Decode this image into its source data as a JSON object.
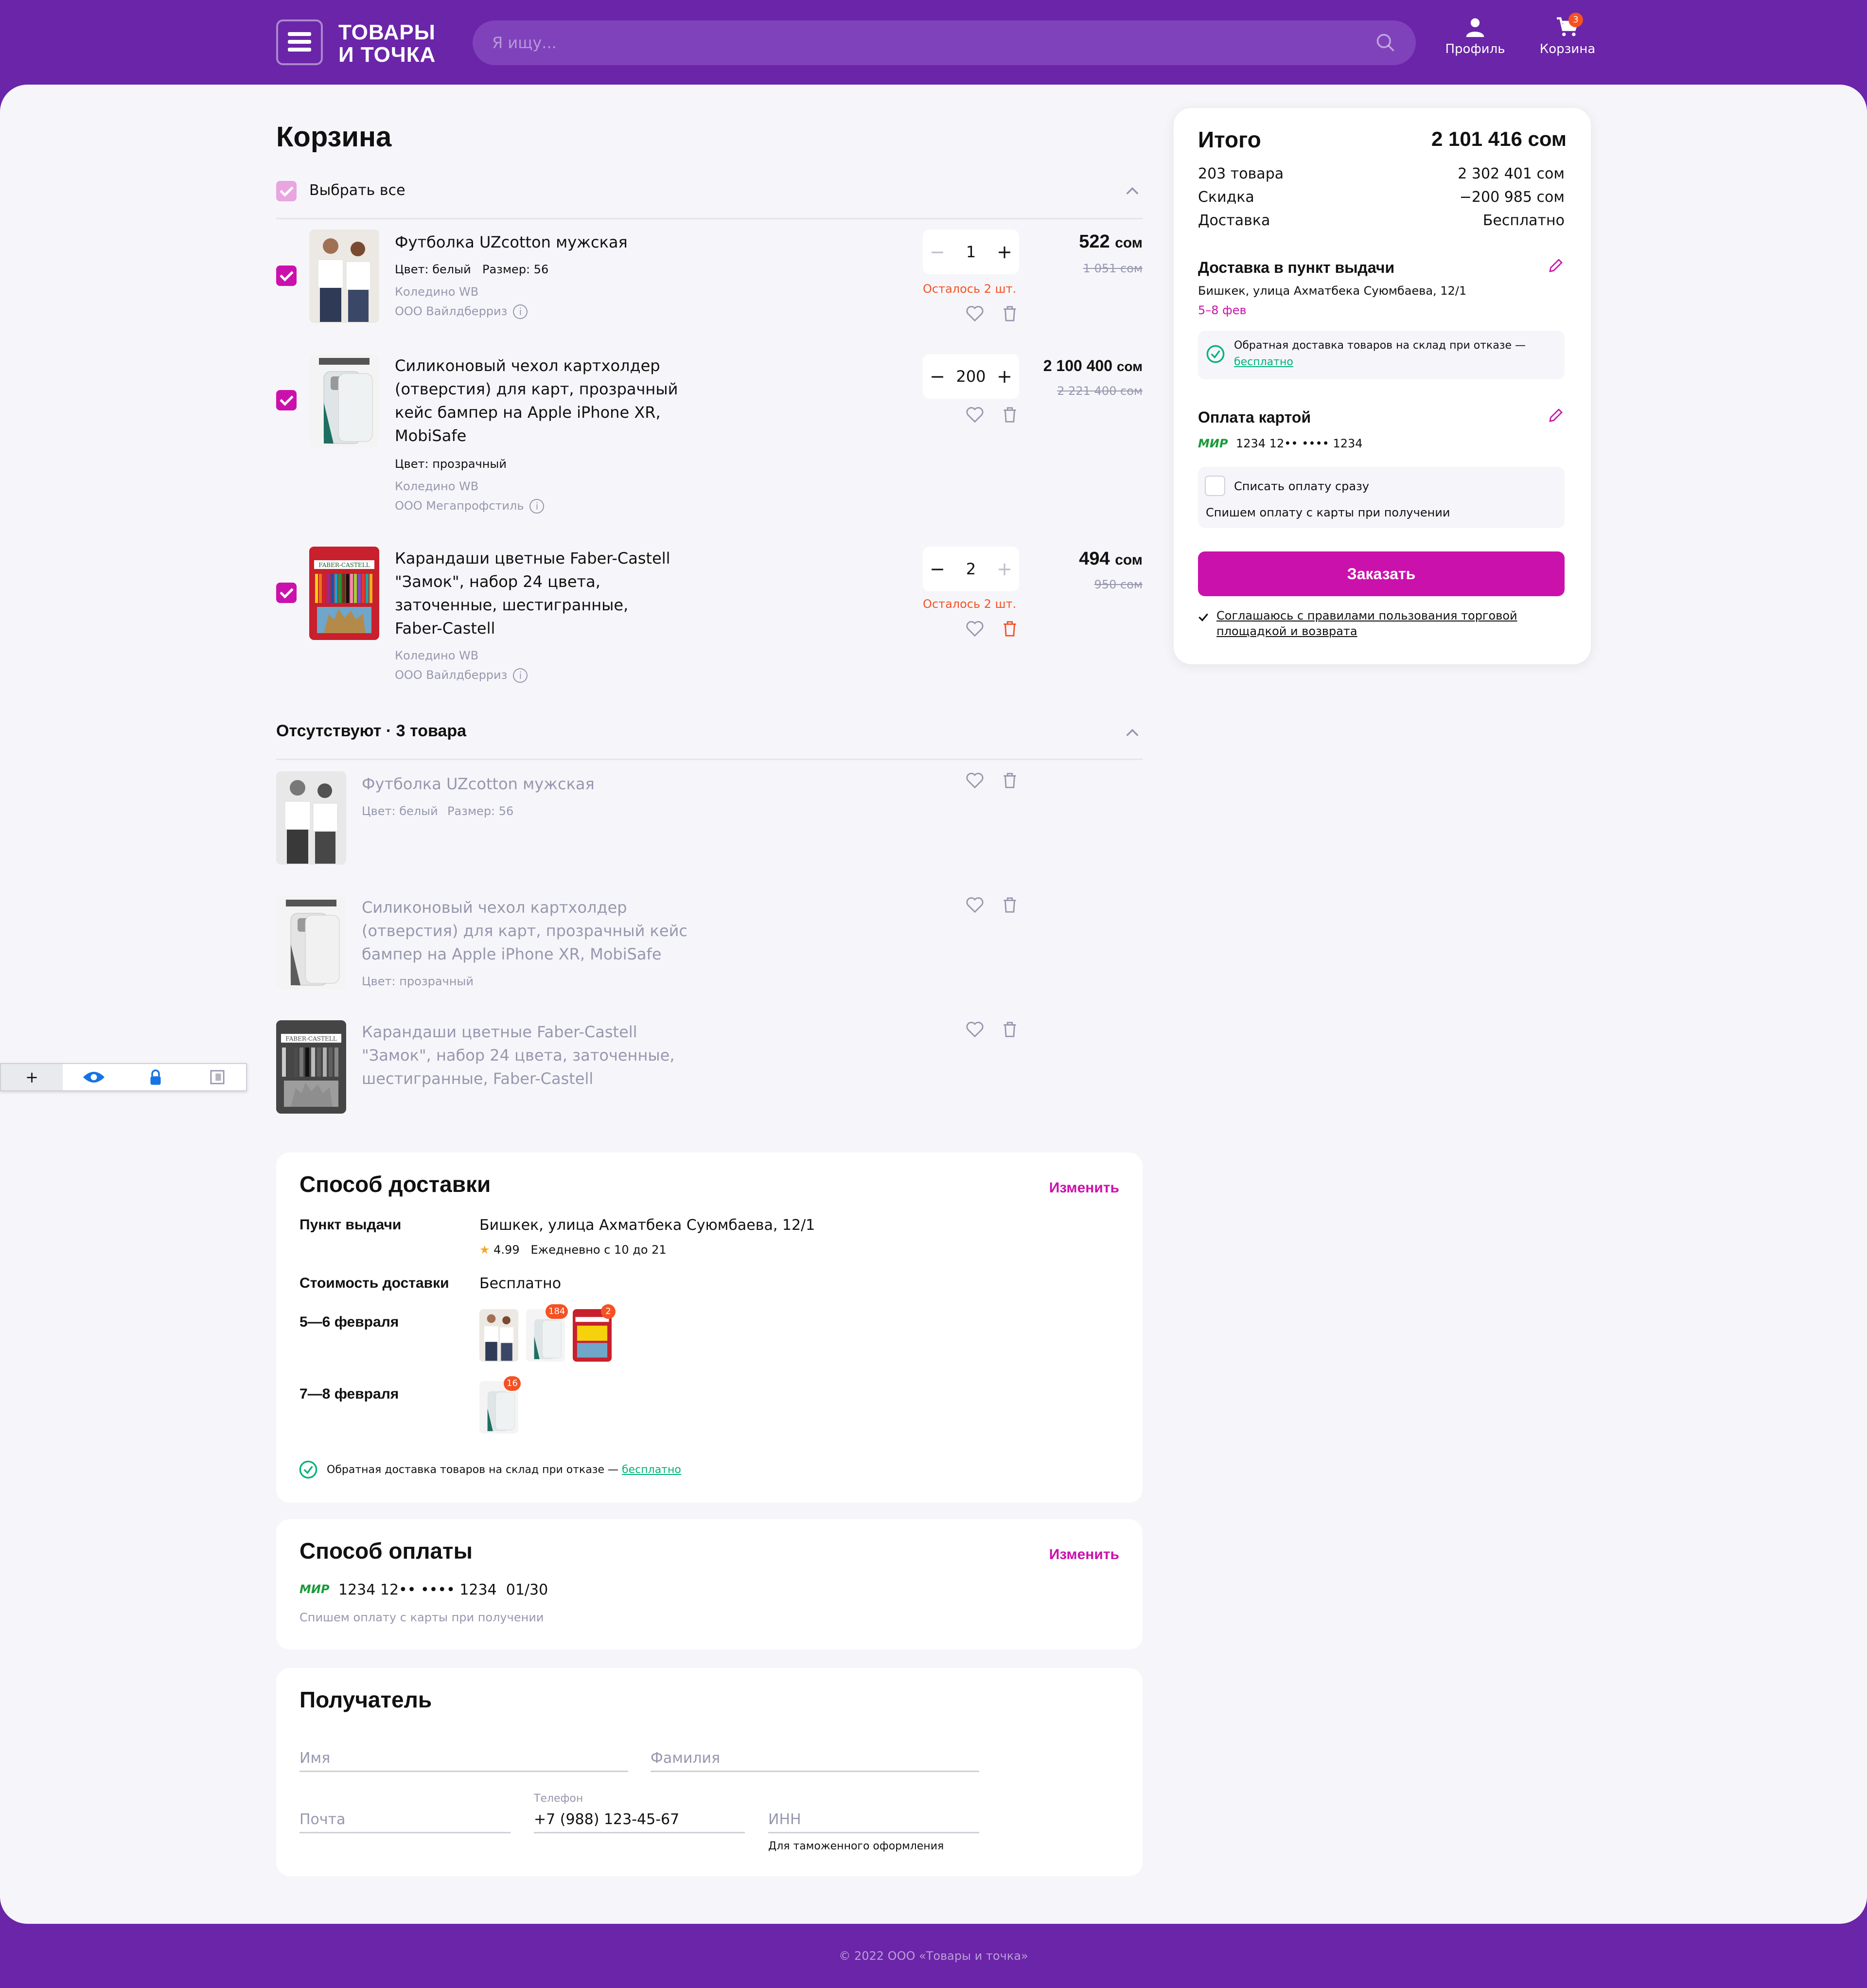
{
  "header": {
    "logo_line1": "ТОВАРЫ",
    "logo_line2": "И ТОЧКА",
    "search_placeholder": "Я ищу...",
    "profile_label": "Профиль",
    "cart_label": "Корзина",
    "cart_count": "3"
  },
  "cart": {
    "title": "Корзина",
    "select_all": "Выбрать все",
    "items": [
      {
        "title": "Футболка UZcotton мужская",
        "color": "Цвет: белый",
        "size": "Размер: 56",
        "warehouse": "Коледино WB",
        "seller": "ООО Вайлдберриз",
        "qty": "1",
        "left_note": "Осталось 2 шт.",
        "price": "522",
        "currency": "сом",
        "old_price": "1 051 сом"
      },
      {
        "title_lines": [
          "Силиконовый чехол картхолдер",
          "(отверстия) для карт, прозрачный",
          "кейс бампер на Apple iPhone XR,",
          "MobiSafe"
        ],
        "color": "Цвет: прозрачный",
        "warehouse": "Коледино WB",
        "seller": "ООО Мегапрофстиль",
        "qty": "200",
        "price": "2 100 400",
        "currency": "сом",
        "old_price": "2 221 400 сом"
      },
      {
        "title_lines": [
          "Карандаши цветные Faber-Castell",
          "\"Замок\", набор 24 цвета,",
          "заточенные, шестигранные,",
          "Faber-Castell"
        ],
        "warehouse": "Коледино WB",
        "seller": "ООО Вайлдберриз",
        "qty": "2",
        "left_note": "Осталось 2 шт.",
        "price": "494",
        "currency": "сом",
        "old_price": "950 сом"
      }
    ]
  },
  "missing": {
    "title": "Отсутствуют · 3 товара",
    "items": [
      {
        "title": "Футболка UZcotton мужская",
        "color": "Цвет: белый",
        "size": "Размер: 56"
      },
      {
        "title_lines": [
          "Силиконовый чехол картхолдер",
          "(отверстия) для карт, прозрачный кейс",
          "бампер на Apple iPhone XR, MobiSafe"
        ],
        "color": "Цвет: прозрачный"
      },
      {
        "title_lines": [
          "Карандаши цветные Faber-Castell",
          "\"Замок\", набор 24 цвета, заточенные,",
          "шестигранные, Faber-Castell"
        ]
      }
    ]
  },
  "summary": {
    "title": "Итого",
    "total": "2 101 416 сом",
    "goods_label": "203 товара",
    "goods_value": "2 302 401 сом",
    "discount_label": "Скидка",
    "discount_value": "−200 985 сом",
    "delivery_label": "Доставка",
    "delivery_value": "Бесплатно",
    "pickup_title": "Доставка в пункт выдачи",
    "pickup_address": "Бишкек, улица Ахматбека Суюмбаева, 12/1",
    "pickup_dates": "5–8 фев",
    "return_text": "Обратная доставка товаров на склад при отказе —",
    "return_free": "бесплатно",
    "payment_title": "Оплата картой",
    "card_brand": "МИР",
    "card_number": "1234 12•• •••• 1234",
    "pay_now": "Списать оплату сразу",
    "pay_note": "Спишем оплату с карты при получении",
    "order_button": "Заказать",
    "agree_line1": "Соглашаюсь с правилами пользования торговой",
    "agree_line2": "площадкой и возврата"
  },
  "delivery": {
    "title": "Способ доставки",
    "edit": "Изменить",
    "point_label": "Пункт выдачи",
    "point_value": "Бишкек, улица Ахматбека Суюмбаева, 12/1",
    "rating": "4.99",
    "schedule": "Ежедневно с 10 до 21",
    "cost_label": "Стоимость доставки",
    "cost_value": "Бесплатно",
    "date1": "5—6 февраля",
    "date2": "7—8 февраля",
    "badge_184": "184",
    "badge_2": "2",
    "badge_16": "16",
    "return_text": "Обратная доставка товаров на склад при отказе —",
    "return_free": "бесплатно"
  },
  "payment": {
    "title": "Способ оплаты",
    "edit": "Изменить",
    "card_brand": "МИР",
    "card_number": "1234 12•• •••• 1234",
    "card_exp": "01/30",
    "note": "Спишем оплату с карты при получении"
  },
  "recipient": {
    "title": "Получатель",
    "name_placeholder": "Имя",
    "surname_placeholder": "Фамилия",
    "email_placeholder": "Почта",
    "phone_label": "Телефон",
    "phone_value": "+7 (988) 123-45-67",
    "inn_placeholder": "ИНН",
    "inn_note": "Для таможенного оформления"
  },
  "footer": {
    "text": "© 2022 ООО «Товары и точка»"
  },
  "colors": {
    "brand": "#6b25a8",
    "accent": "#cb11ab",
    "warning": "#f55123",
    "success": "#00b27a"
  }
}
